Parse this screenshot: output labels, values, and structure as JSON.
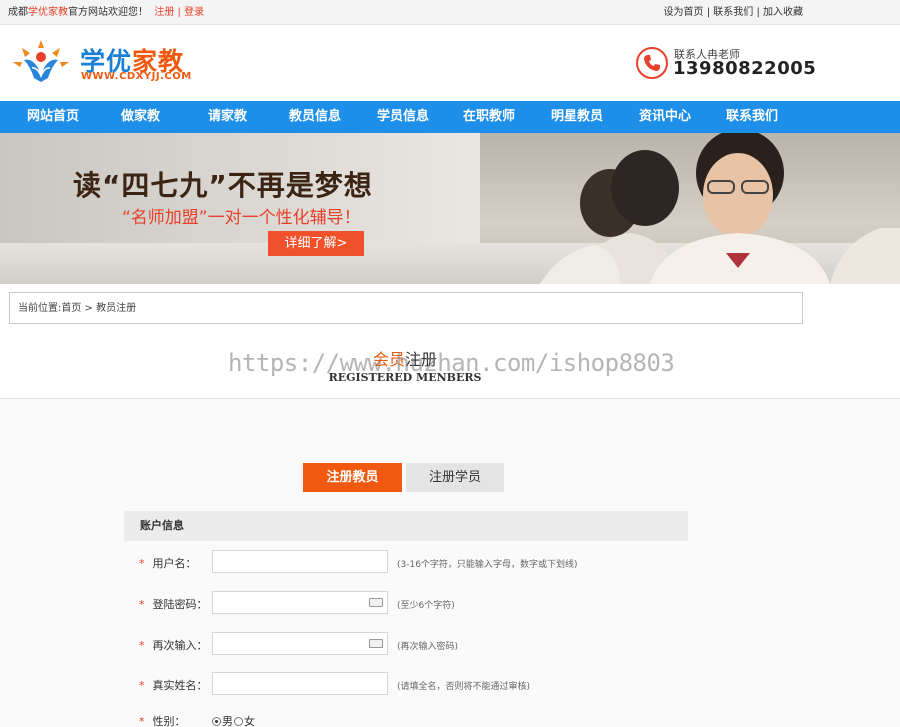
{
  "topbar": {
    "welcome_prefix": "成都",
    "brand": "学优家教",
    "welcome_suffix": "官方网站欢迎您！",
    "register": "注册",
    "separator": "|",
    "login": "登录",
    "set_home": "设为首页",
    "contact_us": "联系我们",
    "add_favorite": "加入收藏"
  },
  "header": {
    "logo_part1": "学优",
    "logo_part2": "家教",
    "logo_url": "WWW.CDXYJJ.COM",
    "contact_label": "联系人冉老师",
    "contact_phone": "13980822005"
  },
  "nav": {
    "items": [
      "网站首页",
      "做家教",
      "请家教",
      "教员信息",
      "学员信息",
      "在职教师",
      "明星教员",
      "资讯中心",
      "联系我们"
    ]
  },
  "banner": {
    "headline": "读“四七九”不再是梦想",
    "tagline": "“名师加盟”一对一个性化辅导！",
    "cta": "详细了解>"
  },
  "breadcrumb": {
    "text": "当前位置:首页 > 教员注册"
  },
  "section": {
    "title_accent": "会员",
    "title_rest": "注册",
    "subtitle": "REGISTERED MENBERS",
    "watermark": "https://www.huzhan.com/ishop8803"
  },
  "tabs": {
    "teacher": "注册教员",
    "student": "注册学员"
  },
  "form": {
    "heading": "账户信息",
    "required_mark": "*",
    "username": {
      "label": "用户名：",
      "value": "",
      "hint": "(3-16个字符，只能输入字母，数字或下划线)"
    },
    "password": {
      "label": "登陆密码：",
      "value": "",
      "hint": "(至少6个字符)"
    },
    "password_confirm": {
      "label": "再次输入：",
      "value": "",
      "hint": "(再次输入密码)"
    },
    "real_name": {
      "label": "真实姓名：",
      "value": "",
      "hint": "(请填全名，否则将不能通过审核)"
    },
    "gender": {
      "label": "性别：",
      "male": "男",
      "female": "女",
      "selected": "男"
    }
  },
  "colors": {
    "nav_blue": "#1e8fe8",
    "accent_orange": "#f0590f",
    "accent_red": "#e8402a"
  }
}
